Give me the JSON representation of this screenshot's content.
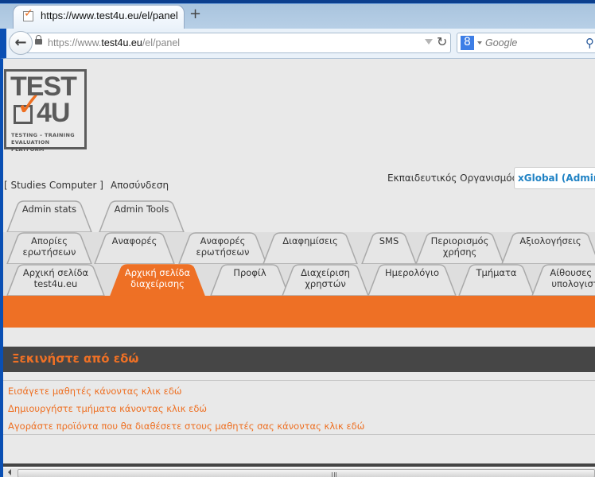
{
  "browser": {
    "tab_title": "https://www.test4u.eu/el/panel",
    "new_tab_symbol": "+",
    "url_prefix": "https://www.",
    "url_domain": "test4u.eu",
    "url_path": "/el/panel",
    "search_placeholder": "Google",
    "search_engine_letter": "8"
  },
  "logo": {
    "line1": "TEST",
    "line2": "4U",
    "tagline1": "TESTING  –  TRAINING",
    "tagline2": "EVALUATION PLATFORM"
  },
  "header": {
    "user_link": "[ Studies Computer ]",
    "logout": "Αποσύνδεση",
    "org_label": "Εκπαιδευτικός Οργανισμός:",
    "org_value": "xGlobal (Admin i"
  },
  "tabs": {
    "row1": [
      {
        "label": "Admin stats"
      },
      {
        "label": "Admin Tools"
      }
    ],
    "row2": [
      {
        "label": "Απορίες ερωτήσεων"
      },
      {
        "label": "Αναφορές"
      },
      {
        "label": "Αναφορές ερωτήσεων"
      },
      {
        "label": "Διαφημίσεις"
      },
      {
        "label": "SMS"
      },
      {
        "label": "Περιορισμός χρήσης"
      },
      {
        "label": "Αξιολογήσεις"
      }
    ],
    "row3": [
      {
        "label": "Αρχική σελίδα test4u.eu"
      },
      {
        "label": "Αρχική σελίδα διαχείρισης",
        "active": true
      },
      {
        "label": "Προφίλ"
      },
      {
        "label": "Διαχείριση χρηστών"
      },
      {
        "label": "Ημερολόγιο"
      },
      {
        "label": "Τμήματα"
      },
      {
        "label": "Αίθουσες κ υπολογιστ"
      }
    ]
  },
  "section": {
    "title": "Ξεκινήστε από εδώ",
    "links": [
      "Εισάγετε μαθητές κάνοντας κλικ εδώ",
      "Δημιουργήστε τμήματα κάνοντας κλικ εδώ",
      "Αγοράστε προϊόντα που θα διαθέσετε στους μαθητές σας κάνοντας κλικ εδώ"
    ]
  },
  "colors": {
    "accent": "#ee7025",
    "section_bg": "#464646",
    "org_text": "#1f82c4"
  }
}
